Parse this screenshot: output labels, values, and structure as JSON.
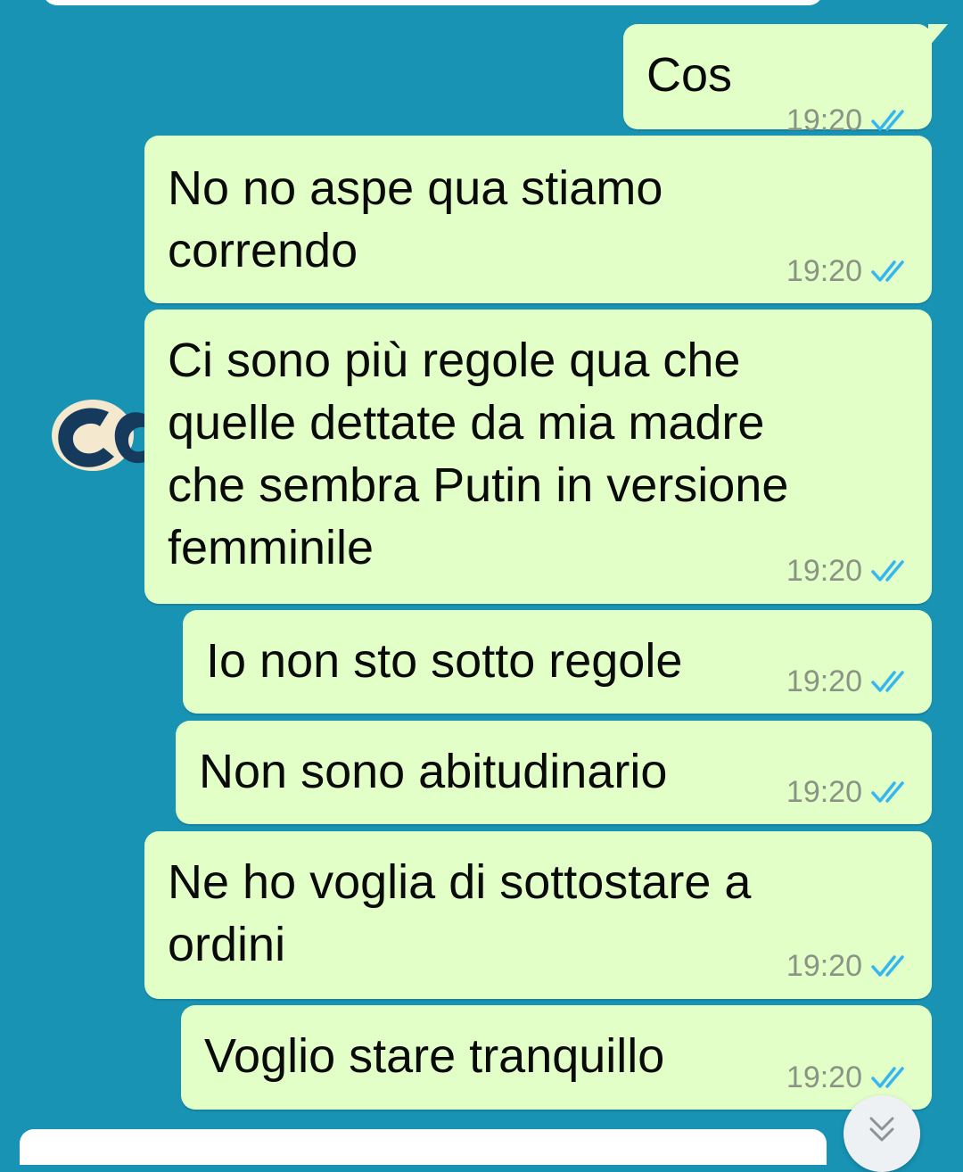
{
  "chat": {
    "messages": [
      {
        "text": "Cos",
        "time": "19:20",
        "status": "read"
      },
      {
        "text": "No no aspe qua stiamo\ncorrendo",
        "time": "19:20",
        "status": "read"
      },
      {
        "text": "Ci sono più regole qua che\nquelle dettate da mia madre\nche sembra Putin in versione\nfemminile",
        "time": "19:20",
        "status": "read"
      },
      {
        "text": "Io non sto sotto regole",
        "time": "19:20",
        "status": "read"
      },
      {
        "text": "Non sono abitudinario",
        "time": "19:20",
        "status": "read"
      },
      {
        "text": "Ne ho voglia di sottostare a\nordini",
        "time": "19:20",
        "status": "read"
      },
      {
        "text": "Voglio stare tranquillo",
        "time": "19:20",
        "status": "read"
      }
    ],
    "scroll_button_icon": "chevron-double-down-icon",
    "read_tick_icon": "double-check-icon"
  },
  "colors": {
    "background": "#1893b4",
    "outgoing_bubble": "#e2ffc7",
    "read_tick": "#34b7f1",
    "timestamp": "#8a9385"
  }
}
